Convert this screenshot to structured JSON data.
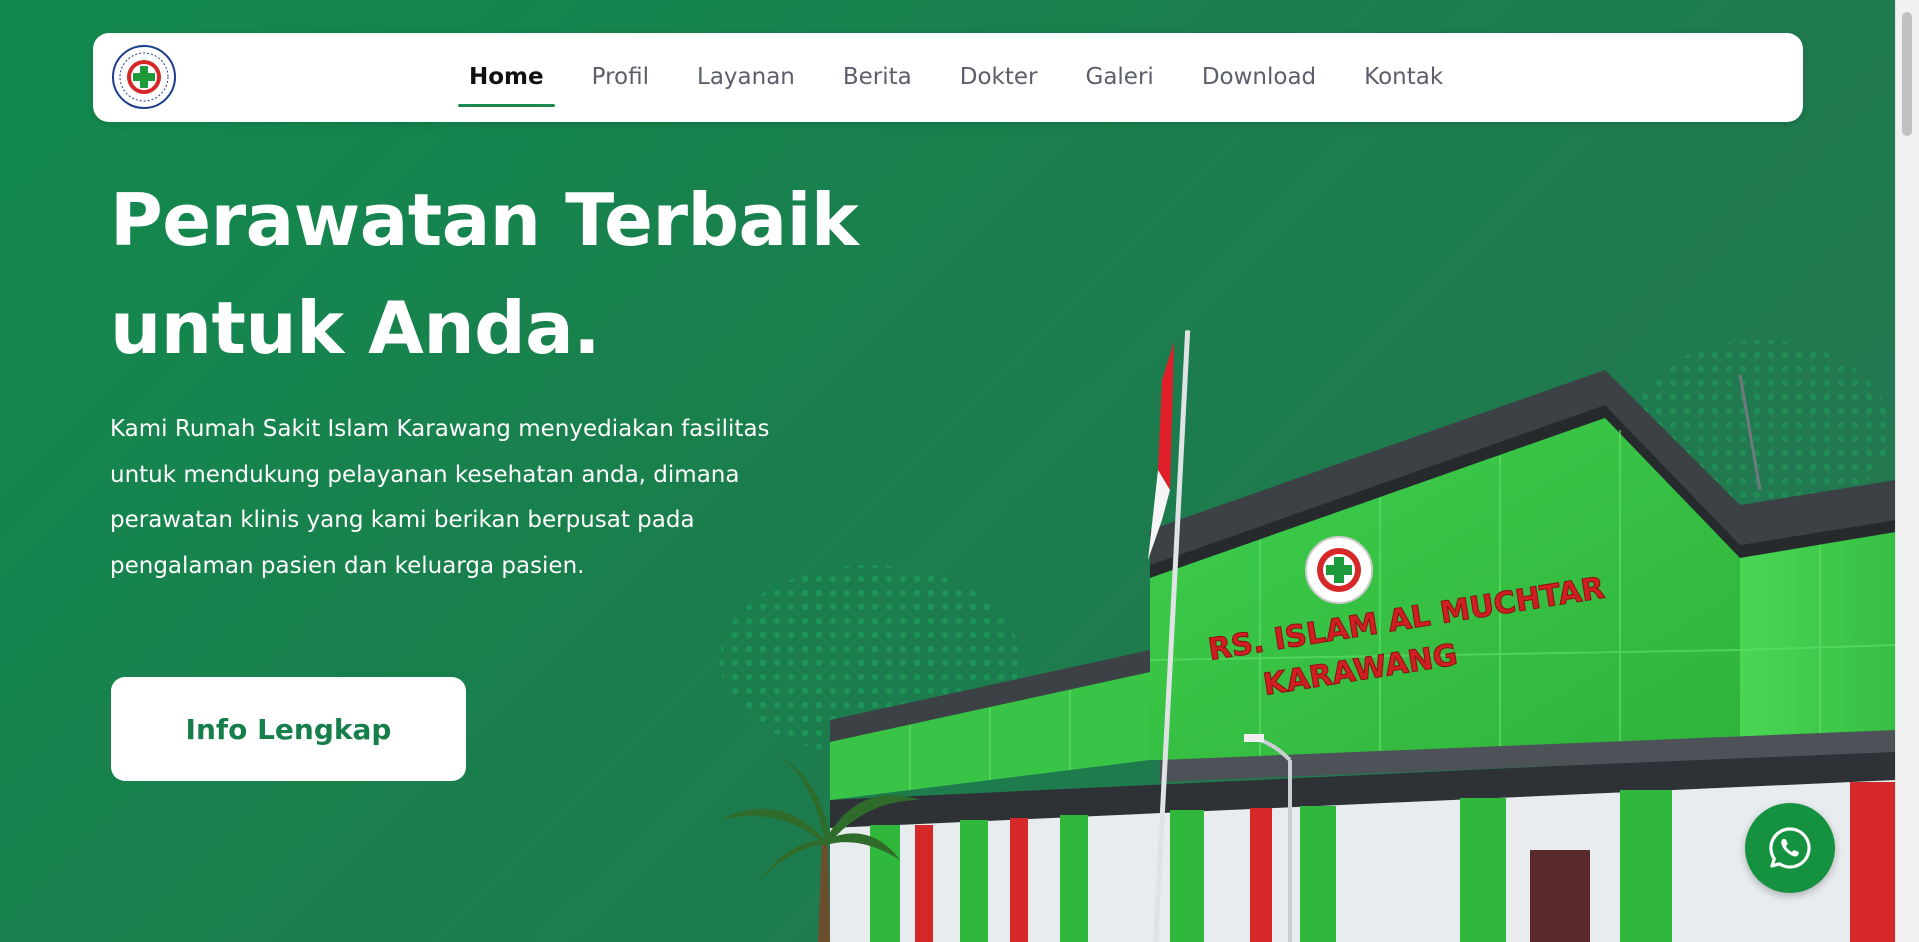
{
  "nav": {
    "logo_icon": "hospital-logo-icon",
    "items": [
      {
        "label": "Home",
        "active": true
      },
      {
        "label": "Profil",
        "active": false
      },
      {
        "label": "Layanan",
        "active": false
      },
      {
        "label": "Berita",
        "active": false
      },
      {
        "label": "Dokter",
        "active": false
      },
      {
        "label": "Galeri",
        "active": false
      },
      {
        "label": "Download",
        "active": false
      },
      {
        "label": "Kontak",
        "active": false
      }
    ]
  },
  "hero": {
    "title_line1": "Perawatan Terbaik",
    "title_line2": "untuk Anda.",
    "description": "Kami Rumah Sakit Islam Karawang menyediakan fasilitas untuk mendukung pelayanan kesehatan anda, dimana perawatan klinis yang kami berikan berpusat pada pengalaman pasien dan keluarga pasien.",
    "cta_label": "Info Lengkap"
  },
  "building": {
    "sign_line1": "RS. ISLAM AL MUCHTAR",
    "sign_line2": "KARAWANG"
  },
  "whatsapp": {
    "icon": "whatsapp-icon"
  },
  "colors": {
    "primary_green": "#1a8a52",
    "background_green": "#1a7e4c",
    "text_white": "#ffffff",
    "whatsapp_green": "#14923f"
  }
}
